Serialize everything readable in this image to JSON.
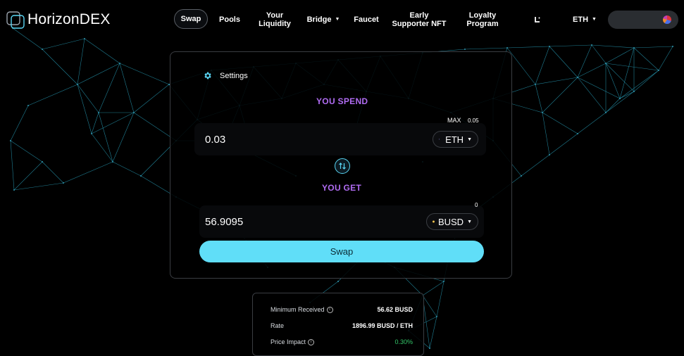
{
  "brand": {
    "name": "HorizonDEX"
  },
  "nav": {
    "swap": "Swap",
    "pools": "Pools",
    "your_liquidity": "Your Liquidity",
    "bridge": "Bridge",
    "faucet": "Faucet",
    "early_supporter": "Early Supporter NFT",
    "loyalty": "Loyalty Program",
    "network": "ETH"
  },
  "swap_card": {
    "settings_label": "Settings",
    "you_spend_label": "YOU SPEND",
    "spend_amount": "0.03",
    "max_label": "MAX",
    "spend_balance": "0.05",
    "spend_token": "ETH",
    "you_get_label": "YOU GET",
    "get_amount": "56.9095",
    "get_balance": "0",
    "get_token": "BUSD",
    "swap_button": "Swap"
  },
  "details": {
    "min_received_label": "Minimum Received",
    "min_received_value": "56.62 BUSD",
    "rate_label": "Rate",
    "rate_value": "1896.99 BUSD / ETH",
    "price_impact_label": "Price Impact",
    "price_impact_value": "0.30%"
  },
  "colors": {
    "accent": "#60def8",
    "section_label": "#b06cf2",
    "positive": "#34c76a",
    "mesh": "#2aa8c4"
  },
  "icons": {
    "settings": "gear-icon",
    "swap_toggle": "swap-arrows-icon",
    "eth": "ethereum-icon",
    "busd": "busd-coin-icon",
    "wallet": "wallet-avatar-icon",
    "nav_extra": "corner-l-icon"
  }
}
